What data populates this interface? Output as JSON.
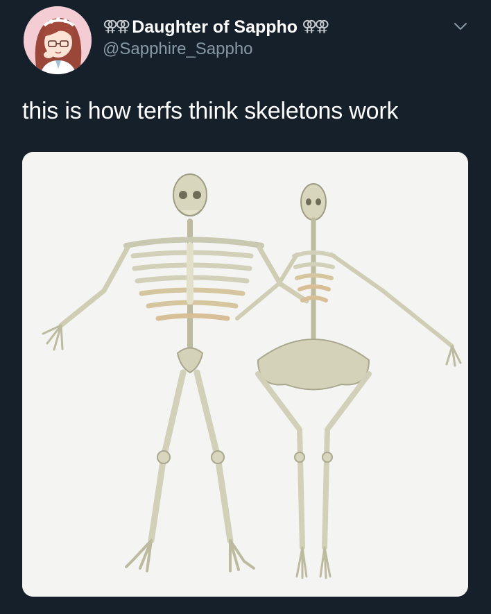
{
  "tweet": {
    "display_name": "Daughter of Sappho",
    "name_emoji_left": "⚢⚢",
    "name_emoji_right": "⚢⚢",
    "handle": "@Sapphire_Sappho",
    "text": "this is how terfs think skeletons work",
    "more_icon": "chevron-down-icon",
    "avatar_icon": "anime-girl-avatar",
    "media_description_icon": "skeletons-image"
  },
  "colors": {
    "background": "#15202b",
    "primary_text": "#ffffff",
    "secondary_text": "#8899a6",
    "media_background": "#f4f4f2"
  }
}
